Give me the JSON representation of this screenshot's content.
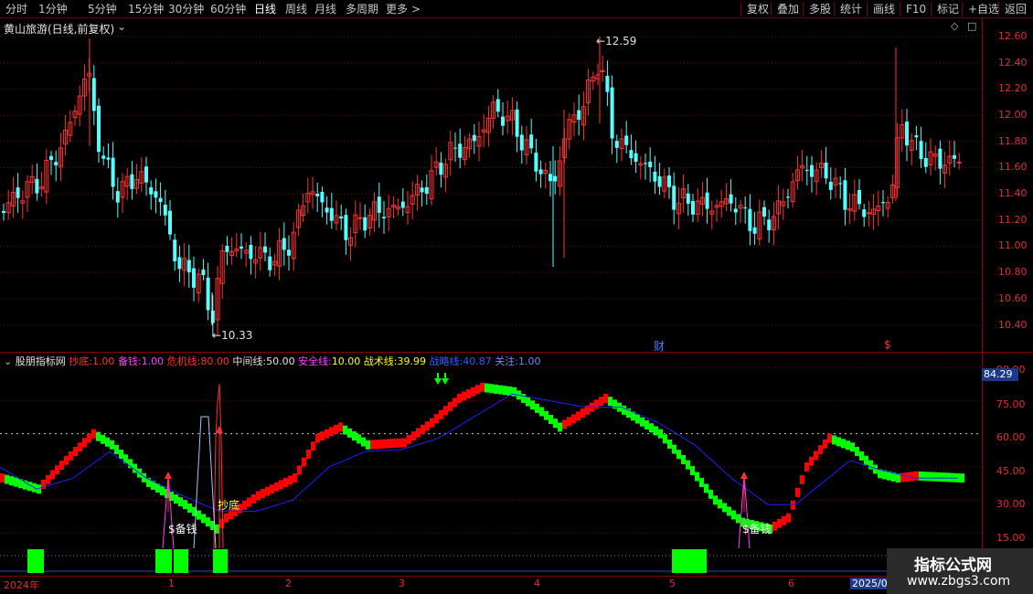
{
  "toolbar": {
    "periods": [
      "分时",
      "1分钟",
      "5分钟",
      "15分钟",
      "30分钟",
      "60分钟",
      "日线",
      "周线",
      "月线",
      "多周期",
      "更多"
    ],
    "active_period": "日线",
    "more_arrow": ">",
    "actions": [
      "复权",
      "叠加",
      "多股",
      "统计",
      "画线",
      "F10",
      "标记",
      "+自选",
      "返回"
    ]
  },
  "main_panel": {
    "title": "黄山旅游(日线,前复权)",
    "high_label": "12.59",
    "low_label": "10.33",
    "event_marks": [
      "财",
      "$"
    ]
  },
  "price_axis": [
    "12.60",
    "12.40",
    "12.20",
    "12.00",
    "11.80",
    "11.60",
    "11.40",
    "11.20",
    "11.00",
    "10.80",
    "10.60",
    "10.40"
  ],
  "indicator": {
    "name": "股朋指标网",
    "params": [
      {
        "label": "抄底:",
        "value": "1.00",
        "color": "#ff3030"
      },
      {
        "label": "备钱:",
        "value": "1.00",
        "color": "#ff40ff"
      },
      {
        "label": "危机线:",
        "value": "80.00",
        "color": "#ff3030"
      },
      {
        "label": "中间线:",
        "value": "50.00",
        "color": "#e0e0e0"
      },
      {
        "label": "安全线:",
        "value": "10.00",
        "color": "#ffff00"
      },
      {
        "label": "战术线:",
        "value": "39.99",
        "color": "#ffff00"
      },
      {
        "label": "战略线:",
        "value": "40.87",
        "color": "#3060ff"
      },
      {
        "label": "关注:",
        "value": "1.00",
        "color": "#8080ff"
      }
    ],
    "current_value": "84.29",
    "markers": {
      "buy": "抄底",
      "cash1": "$备钱",
      "cash2": "$备钱"
    }
  },
  "indicator_axis": [
    "90.00",
    "75.00",
    "60.00",
    "45.00",
    "30.00",
    "15.00"
  ],
  "date_axis": [
    "2024年",
    "1",
    "2",
    "3",
    "4",
    "5",
    "6",
    "2025/07"
  ],
  "watermark": {
    "line1": "指标公式网",
    "line2": "www.zbgs3.com"
  },
  "colors": {
    "up": "#ff3232",
    "down": "#54ffff",
    "ind_up": "#ff0000",
    "ind_down": "#00ff00",
    "strategy": "#2020ff",
    "grid": "#8b0000"
  },
  "chart_data": {
    "type": "candlestick",
    "price_range": [
      10.33,
      12.59
    ],
    "ylim": [
      10.33,
      12.66
    ],
    "indicator_ylim": [
      0,
      90
    ]
  }
}
